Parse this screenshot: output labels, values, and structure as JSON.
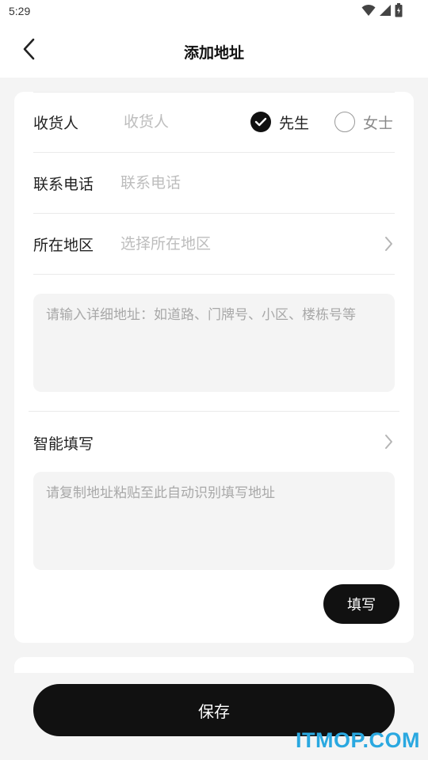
{
  "status_bar": {
    "time": "5:29",
    "icons": [
      "wifi-icon",
      "signal-icon",
      "battery-icon"
    ]
  },
  "header": {
    "title": "添加地址",
    "back_icon": "chevron-left-icon"
  },
  "form": {
    "consignee": {
      "label": "收货人",
      "placeholder": "收货人",
      "value": ""
    },
    "gender": {
      "options": [
        {
          "label": "先生",
          "selected": true
        },
        {
          "label": "女士",
          "selected": false
        }
      ]
    },
    "phone": {
      "label": "联系电话",
      "placeholder": "联系电话",
      "value": ""
    },
    "region": {
      "label": "所在地区",
      "placeholder": "选择所在地区",
      "value": ""
    },
    "detail_address": {
      "placeholder": "请输入详细地址：如道路、门牌号、小区、楼栋号等",
      "value": ""
    },
    "smart_fill": {
      "label": "智能填写",
      "placeholder": "请复制地址粘贴至此自动识别填写地址",
      "value": "",
      "button_label": "填写"
    }
  },
  "footer": {
    "save_label": "保存"
  },
  "watermark": {
    "text": "ITMOP.COM"
  },
  "colors": {
    "primary": "#111111",
    "background": "#f4f4f4",
    "card": "#ffffff",
    "placeholder": "#bdbdbd",
    "watermark": "#2aa8e0"
  }
}
